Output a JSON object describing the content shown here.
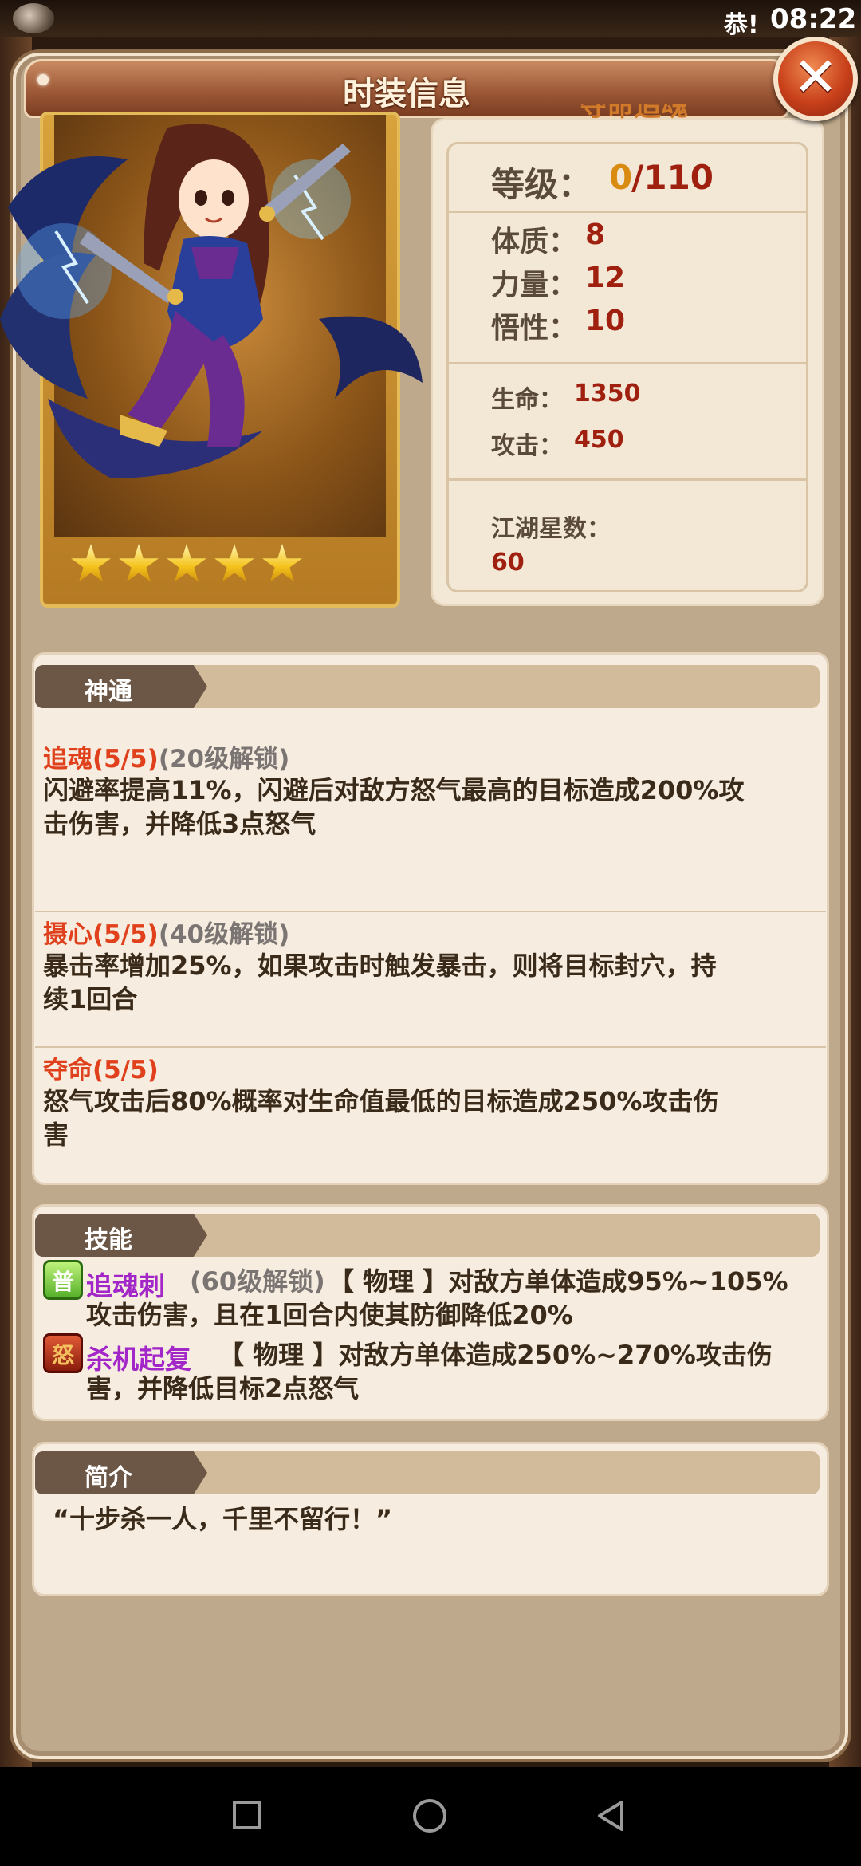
{
  "status_bar": {
    "notification": "恭!",
    "time": "08:22"
  },
  "header": {
    "title": "时装信息",
    "close_label": "✕"
  },
  "portrait": {
    "title_fragment": "夺命追魂",
    "star_count": 5
  },
  "stats": {
    "level_label": "等级：",
    "level_current": "0",
    "level_max": "/110",
    "attributes": [
      {
        "label": "体质：",
        "value": "8"
      },
      {
        "label": "力量：",
        "value": "12"
      },
      {
        "label": "悟性：",
        "value": "10"
      }
    ],
    "combat": [
      {
        "label": "生命：",
        "value": "1350"
      },
      {
        "label": "攻击：",
        "value": "450"
      }
    ],
    "stars_label": "江湖星数：",
    "stars_value": "60"
  },
  "shentong": {
    "title": "神通",
    "items": [
      {
        "name": "追魂(5/5)",
        "lock": "(20级解锁)",
        "desc_line1": "闪避率提高11%，闪避后对敌方怒气最高的目标造成200%攻",
        "desc_line2": "击伤害，并降低3点怒气"
      },
      {
        "name": "摄心(5/5)",
        "lock": "(40级解锁)",
        "desc_line1": "暴击率增加25%，如果攻击时触发暴击，则将目标封穴，持",
        "desc_line2": "续1回合"
      },
      {
        "name": "夺命(5/5)",
        "lock": "",
        "desc_line1": "怒气攻击后80%概率对生命值最低的目标造成250%攻击伤",
        "desc_line2": "害"
      }
    ]
  },
  "skills": {
    "title": "技能",
    "items": [
      {
        "icon_text": "普",
        "icon": "normal-attack-icon",
        "name": "追魂刺",
        "lock": "(60级解锁)",
        "line1": "【 物理 】对敌方单体造成95%~105%",
        "line2": "攻击伤害，且在1回合内使其防御降低20%"
      },
      {
        "icon_text": "怒",
        "icon": "rage-skill-icon",
        "name": "杀机起复",
        "lock": "",
        "line1": "【 物理 】对敌方单体造成250%~270%攻击伤",
        "line2": "害，并降低目标2点怒气"
      }
    ]
  },
  "intro": {
    "title": "简介",
    "quote": "“十步杀一人，千里不留行！”"
  },
  "colors": {
    "skill_name": "#e0401c",
    "stat_value": "#a02010",
    "ability_name": "#a226c8",
    "level_current": "#d98a10"
  }
}
